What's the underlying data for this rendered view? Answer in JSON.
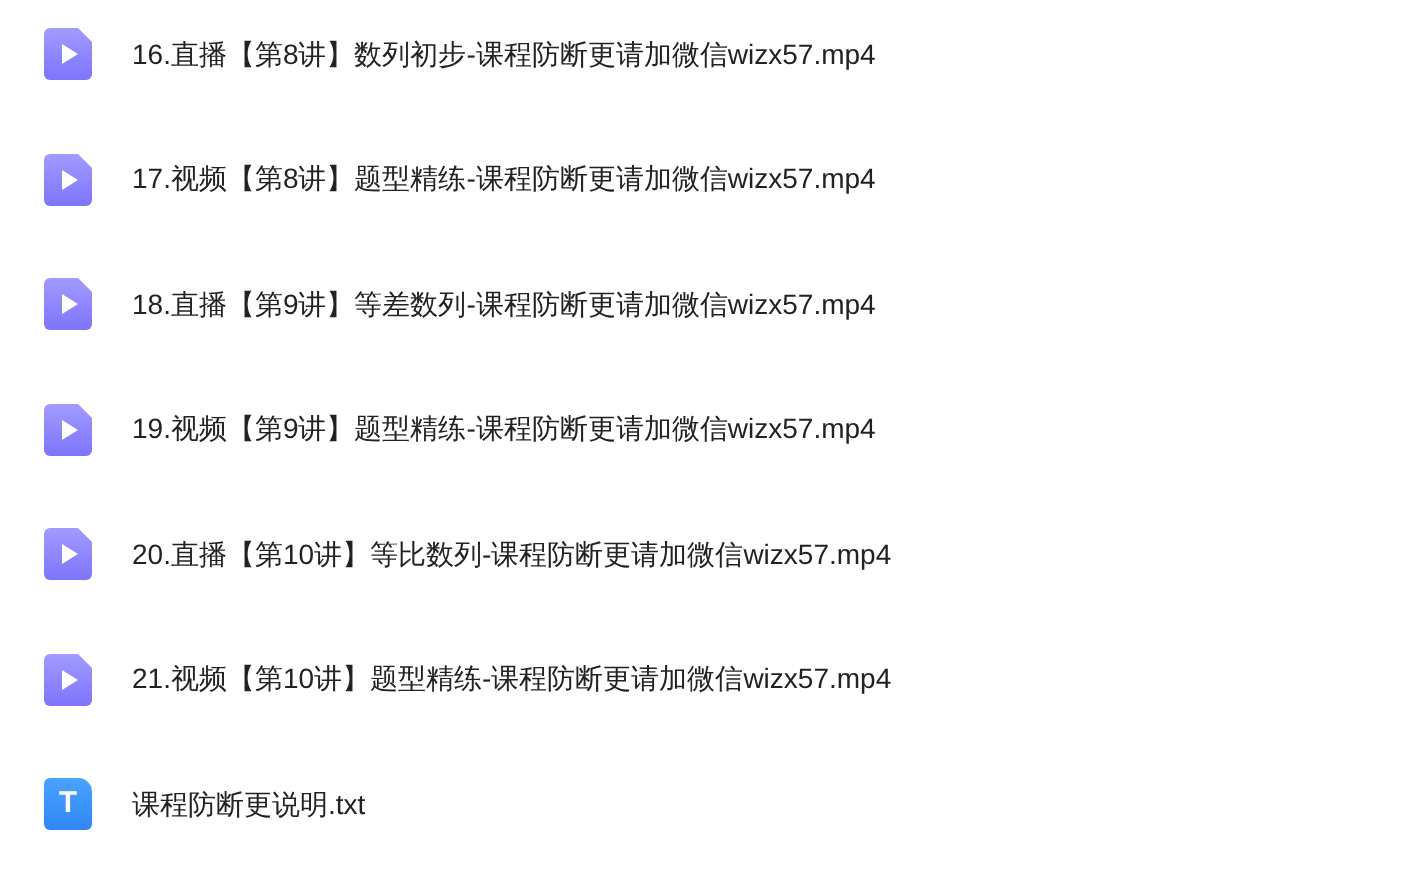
{
  "files": [
    {
      "kind": "video",
      "name": "16.直播【第8讲】数列初步-课程防断更请加微信wizx57.mp4"
    },
    {
      "kind": "video",
      "name": "17.视频【第8讲】题型精练-课程防断更请加微信wizx57.mp4"
    },
    {
      "kind": "video",
      "name": "18.直播【第9讲】等差数列-课程防断更请加微信wizx57.mp4"
    },
    {
      "kind": "video",
      "name": "19.视频【第9讲】题型精练-课程防断更请加微信wizx57.mp4"
    },
    {
      "kind": "video",
      "name": "20.直播【第10讲】等比数列-课程防断更请加微信wizx57.mp4"
    },
    {
      "kind": "video",
      "name": "21.视频【第10讲】题型精练-课程防断更请加微信wizx57.mp4"
    },
    {
      "kind": "text",
      "icon_glyph": "T",
      "name": "课程防断更说明.txt"
    }
  ]
}
